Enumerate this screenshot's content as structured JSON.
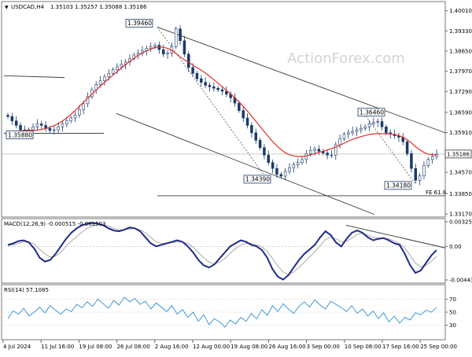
{
  "chart_data": [
    {
      "type": "candlestick",
      "title": "USDCAD,H4",
      "ohlc_readout": [
        "1.35103",
        "1.35257",
        "1.35088",
        "1.35186"
      ],
      "current_price": 1.35186,
      "current_price_label": "1.35186",
      "watermark": "ActionForex.com",
      "ylim": [
        1.3317,
        1.4
      ],
      "y_ticks": [
        "1.40010",
        "1.39330",
        "1.38650",
        "1.37970",
        "1.37290",
        "1.36590",
        "1.35910",
        "1.35186",
        "1.34570",
        "1.33850",
        "1.33170"
      ],
      "y_tick_values": [
        1.4001,
        1.3933,
        1.3865,
        1.3797,
        1.3729,
        1.3659,
        1.3591,
        1.35186,
        1.3457,
        1.3385,
        1.3317
      ],
      "x_ticks": [
        "4 Jul 2024",
        "11 Jul 16:00",
        "19 Jul 08:00",
        "26 Jul 08:00",
        "2 Aug 16:00",
        "12 Aug 00:00",
        "19 Aug 08:00",
        "26 Aug 16:00",
        "3 Sep 00:00",
        "10 Sep 08:00",
        "17 Sep 16:00",
        "25 Sep 00:00"
      ],
      "annotations": [
        {
          "label": "1.39460",
          "price": 1.3946
        },
        {
          "label": "1.35880",
          "price": 1.3588
        },
        {
          "label": "1.34390",
          "price": 1.3439
        },
        {
          "label": "1.36460",
          "price": 1.3646
        },
        {
          "label": "1.34180",
          "price": 1.3418
        },
        {
          "label": "FE 61.8",
          "price": 1.3378
        }
      ],
      "close": [
        1.3645,
        1.363,
        1.3615,
        1.36,
        1.3592,
        1.36,
        1.361,
        1.362,
        1.3615,
        1.3605,
        1.3598,
        1.36,
        1.361,
        1.362,
        1.363,
        1.364,
        1.365,
        1.3668,
        1.3688,
        1.3712,
        1.3735,
        1.3752,
        1.3765,
        1.3778,
        1.379,
        1.3802,
        1.3812,
        1.382,
        1.3828,
        1.384,
        1.3852,
        1.3858,
        1.3866,
        1.3874,
        1.388,
        1.3885,
        1.387,
        1.3855,
        1.3858,
        1.388,
        1.394,
        1.39,
        1.3855,
        1.381,
        1.379,
        1.3772,
        1.376,
        1.375,
        1.3745,
        1.374,
        1.3735,
        1.373,
        1.372,
        1.3708,
        1.369,
        1.3665,
        1.364,
        1.3615,
        1.359,
        1.3565,
        1.354,
        1.3515,
        1.349,
        1.347,
        1.345,
        1.3444,
        1.346,
        1.3472,
        1.3482,
        1.349,
        1.35,
        1.352,
        1.353,
        1.3535,
        1.3528,
        1.3522,
        1.3515,
        1.3515,
        1.355,
        1.357,
        1.3585,
        1.359,
        1.3595,
        1.36,
        1.3605,
        1.361,
        1.362,
        1.3625,
        1.3628,
        1.361,
        1.359,
        1.3585,
        1.358,
        1.3575,
        1.356,
        1.352,
        1.347,
        1.343,
        1.3445,
        1.348,
        1.35,
        1.351,
        1.3518
      ],
      "ma": [
        1.359,
        1.3592,
        1.3594,
        1.3596,
        1.3598,
        1.3598,
        1.3598,
        1.3599,
        1.3601,
        1.3604,
        1.3609,
        1.3614,
        1.3621,
        1.363,
        1.364,
        1.3652,
        1.3665,
        1.3679,
        1.3693,
        1.3707,
        1.372,
        1.3734,
        1.3747,
        1.376,
        1.3772,
        1.3784,
        1.3796,
        1.3808,
        1.382,
        1.3831,
        1.3841,
        1.3851,
        1.3859,
        1.3866,
        1.3872,
        1.3877,
        1.3879,
        1.3878,
        1.3874,
        1.3867,
        1.3857,
        1.3846,
        1.3836,
        1.3827,
        1.3818,
        1.3809,
        1.3801,
        1.3791,
        1.378,
        1.3769,
        1.3757,
        1.3745,
        1.3733,
        1.3721,
        1.3708,
        1.3694,
        1.3679,
        1.3663,
        1.3646,
        1.3629,
        1.3611,
        1.3594,
        1.3577,
        1.356,
        1.3546,
        1.3533,
        1.3523,
        1.3516,
        1.3512,
        1.351,
        1.351,
        1.3512,
        1.3516,
        1.352,
        1.3524,
        1.3528,
        1.3532,
        1.3537,
        1.3542,
        1.3548,
        1.3555,
        1.3562,
        1.3568,
        1.3573,
        1.3577,
        1.3581,
        1.3584,
        1.3586,
        1.3587,
        1.3587,
        1.3587,
        1.3586,
        1.3584,
        1.3581,
        1.3575,
        1.3567,
        1.3556,
        1.3543,
        1.3533,
        1.3524,
        1.3518,
        1.3516,
        1.3515
      ]
    },
    {
      "type": "line",
      "title": "MACD(12,26,9) -0.000515 -0.001503",
      "ylim": [
        -0.004439,
        0.003259
      ],
      "y_ticks": [
        "0.003259",
        "0.00",
        "-0.004439"
      ],
      "y_tick_values": [
        0.003259,
        0.0,
        -0.004439
      ],
      "series": [
        {
          "name": "MACD",
          "values": [
            0.0002,
            0.0004,
            0.0007,
            0.0008,
            0.0005,
            -0.0003,
            -0.0015,
            -0.002,
            -0.0018,
            -0.001,
            0.0,
            0.001,
            0.0018,
            0.0024,
            0.0028,
            0.003,
            0.0031,
            0.003,
            0.0028,
            0.0024,
            0.0021,
            0.002,
            0.0022,
            0.0025,
            0.0024,
            0.002,
            0.0012,
            0.0004,
            0.0,
            0.0002,
            0.0004,
            0.0006,
            0.0008,
            0.0006,
            0.0,
            -0.0008,
            -0.0018,
            -0.0025,
            -0.0028,
            -0.0024,
            -0.0016,
            -0.0008,
            0.0,
            0.0004,
            0.0008,
            0.0006,
            0.0002,
            0.0,
            -0.0005,
            -0.0015,
            -0.003,
            -0.004,
            -0.0044,
            -0.0038,
            -0.0028,
            -0.0018,
            -0.001,
            -0.0004,
            0.0002,
            0.0012,
            0.002,
            0.0015,
            0.0005,
            0.0,
            0.001,
            0.0018,
            0.0021,
            0.0018,
            0.0012,
            0.0008,
            0.001,
            0.0011,
            0.0008,
            0.0004,
            0.0002,
            -0.001,
            -0.0025,
            -0.0035,
            -0.0032,
            -0.0022,
            -0.0012,
            -0.0005
          ]
        },
        {
          "name": "Signal",
          "values": [
            0.0001,
            0.0002,
            0.0004,
            0.0006,
            0.0006,
            0.0003,
            -0.0004,
            -0.001,
            -0.0014,
            -0.0013,
            -0.0008,
            0.0,
            0.0007,
            0.0013,
            0.0019,
            0.0024,
            0.0027,
            0.0029,
            0.0029,
            0.0027,
            0.0024,
            0.0022,
            0.0022,
            0.0023,
            0.0024,
            0.0022,
            0.0018,
            0.0012,
            0.0006,
            0.0004,
            0.0004,
            0.0005,
            0.0006,
            0.0006,
            0.0004,
            -0.0001,
            -0.0008,
            -0.0015,
            -0.0021,
            -0.0023,
            -0.0021,
            -0.0016,
            -0.0009,
            -0.0003,
            0.0002,
            0.0004,
            0.0004,
            0.0002,
            -0.0001,
            -0.0007,
            -0.0016,
            -0.0026,
            -0.0034,
            -0.0037,
            -0.0034,
            -0.0028,
            -0.0021,
            -0.0014,
            -0.0007,
            0.0001,
            0.0009,
            0.0012,
            0.001,
            0.0006,
            0.0007,
            0.0011,
            0.0016,
            0.0017,
            0.0015,
            0.0012,
            0.0011,
            0.0011,
            0.001,
            0.0007,
            0.0004,
            -0.0002,
            -0.0012,
            -0.0022,
            -0.0027,
            -0.0025,
            -0.002,
            -0.0013
          ]
        }
      ]
    },
    {
      "type": "line",
      "title": "RSI(14) 57.1085",
      "ylim": [
        0,
        100
      ],
      "y_ticks": [
        "70",
        "50",
        "30"
      ],
      "y_tick_values": [
        70,
        50,
        30
      ],
      "series": [
        {
          "values": [
            40,
            52,
            47,
            56,
            44,
            50,
            58,
            49,
            60,
            53,
            47,
            55,
            51,
            62,
            57,
            66,
            59,
            70,
            63,
            56,
            68,
            61,
            73,
            66,
            71,
            62,
            67,
            55,
            64,
            58,
            51,
            60,
            47,
            54,
            42,
            50,
            36,
            46,
            31,
            40,
            35,
            27,
            38,
            32,
            42,
            36,
            48,
            40,
            54,
            45,
            60,
            51,
            63,
            55,
            48,
            59,
            66,
            58,
            69,
            61,
            55,
            67,
            62,
            57,
            51,
            60,
            48,
            55,
            44,
            52,
            40,
            49,
            35,
            44,
            33,
            42,
            38,
            49,
            46,
            53,
            50,
            57
          ]
        }
      ]
    }
  ]
}
